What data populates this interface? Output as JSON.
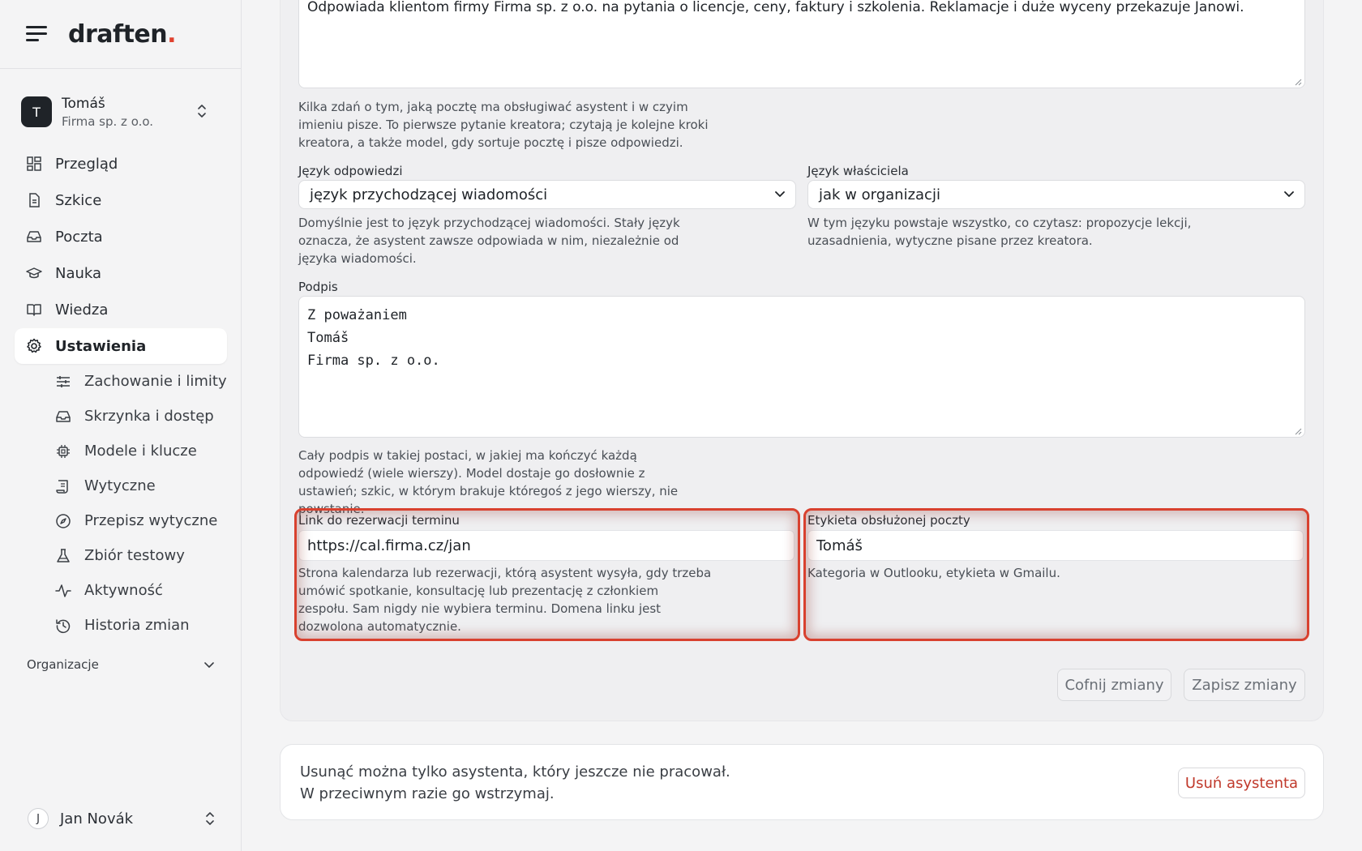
{
  "brand": {
    "name": "draften",
    "dot": "."
  },
  "account": {
    "initial": "T",
    "name": "Tomáš",
    "company": "Firma sp. z o.o."
  },
  "nav": [
    {
      "label": "Przegląd",
      "icon": "dashboard-icon"
    },
    {
      "label": "Szkice",
      "icon": "document-icon"
    },
    {
      "label": "Poczta",
      "icon": "inbox-icon"
    },
    {
      "label": "Nauka",
      "icon": "graduation-cap-icon"
    },
    {
      "label": "Wiedza",
      "icon": "book-icon"
    },
    {
      "label": "Ustawienia",
      "icon": "gear-icon",
      "active": true
    }
  ],
  "subnav": [
    {
      "label": "Zachowanie i limity",
      "icon": "sliders-icon"
    },
    {
      "label": "Skrzynka i dostęp",
      "icon": "inbox-icon"
    },
    {
      "label": "Modele i klucze",
      "icon": "chip-icon"
    },
    {
      "label": "Wytyczne",
      "icon": "scroll-icon"
    },
    {
      "label": "Przepisz wytyczne",
      "icon": "compass-icon"
    },
    {
      "label": "Zbiór testowy",
      "icon": "flask-icon"
    },
    {
      "label": "Aktywność",
      "icon": "activity-icon"
    },
    {
      "label": "Historia zmian",
      "icon": "history-icon"
    }
  ],
  "organizations_label": "Organizacje",
  "user": {
    "initial": "J",
    "name": "Jan Novák"
  },
  "form": {
    "description_value": "Odpowiada klientom firmy Firma sp. z o.o. na pytania o licencje, ceny, faktury i szkolenia. Reklamacje i duże wyceny przekazuje Janowi.",
    "description_help": "Kilka zdań o tym, jaką pocztę ma obsługiwać asystent i w czyim imieniu pisze. To pierwsze pytanie kreatora; czytają je kolejne kroki kreatora, a także model, gdy sortuje pocztę i pisze odpowiedzi.",
    "reply_language_label": "Język odpowiedzi",
    "reply_language_value": "język przychodzącej wiadomości",
    "reply_language_help": "Domyślnie jest to język przychodzącej wiadomości. Stały język oznacza, że asystent zawsze odpowiada w nim, niezależnie od języka wiadomości.",
    "owner_language_label": "Język właściciela",
    "owner_language_value": "jak w organizacji",
    "owner_language_help": "W tym języku powstaje wszystko, co czytasz: propozycje lekcji, uzasadnienia, wytyczne pisane przez kreatora.",
    "signature_label": "Podpis",
    "signature_value": "Z poważaniem\nTomáš\nFirma sp. z o.o.",
    "signature_help": "Cały podpis w takiej postaci, w jakiej ma kończyć każdą odpowiedź (wiele wierszy). Model dostaje go dosłownie z ustawień; szkic, w którym brakuje któregoś z jego wierszy, nie powstanie.",
    "booking_label": "Link do rezerwacji terminu",
    "booking_value": "https://cal.firma.cz/jan",
    "booking_help": "Strona kalendarza lub rezerwacji, którą asystent wysyła, gdy trzeba umówić spotkanie, konsultację lub prezentację z członkiem zespołu. Sam nigdy nie wybiera terminu. Domena linku jest dozwolona automatycznie.",
    "handled_label": "Etykieta obsłużonej poczty",
    "handled_value": "Tomáš",
    "handled_help": "Kategoria w Outlooku, etykieta w Gmailu.",
    "revert_label": "Cofnij zmiany",
    "save_label": "Zapisz zmiany"
  },
  "danger": {
    "message": "Usunąć można tylko asystenta, który jeszcze nie pracował. W przeciwnym razie go wstrzymaj.",
    "button_label": "Usuń asystenta"
  },
  "colors": {
    "accent": "#e0422f",
    "danger": "#c0392b",
    "highlight": "#d8412f"
  }
}
